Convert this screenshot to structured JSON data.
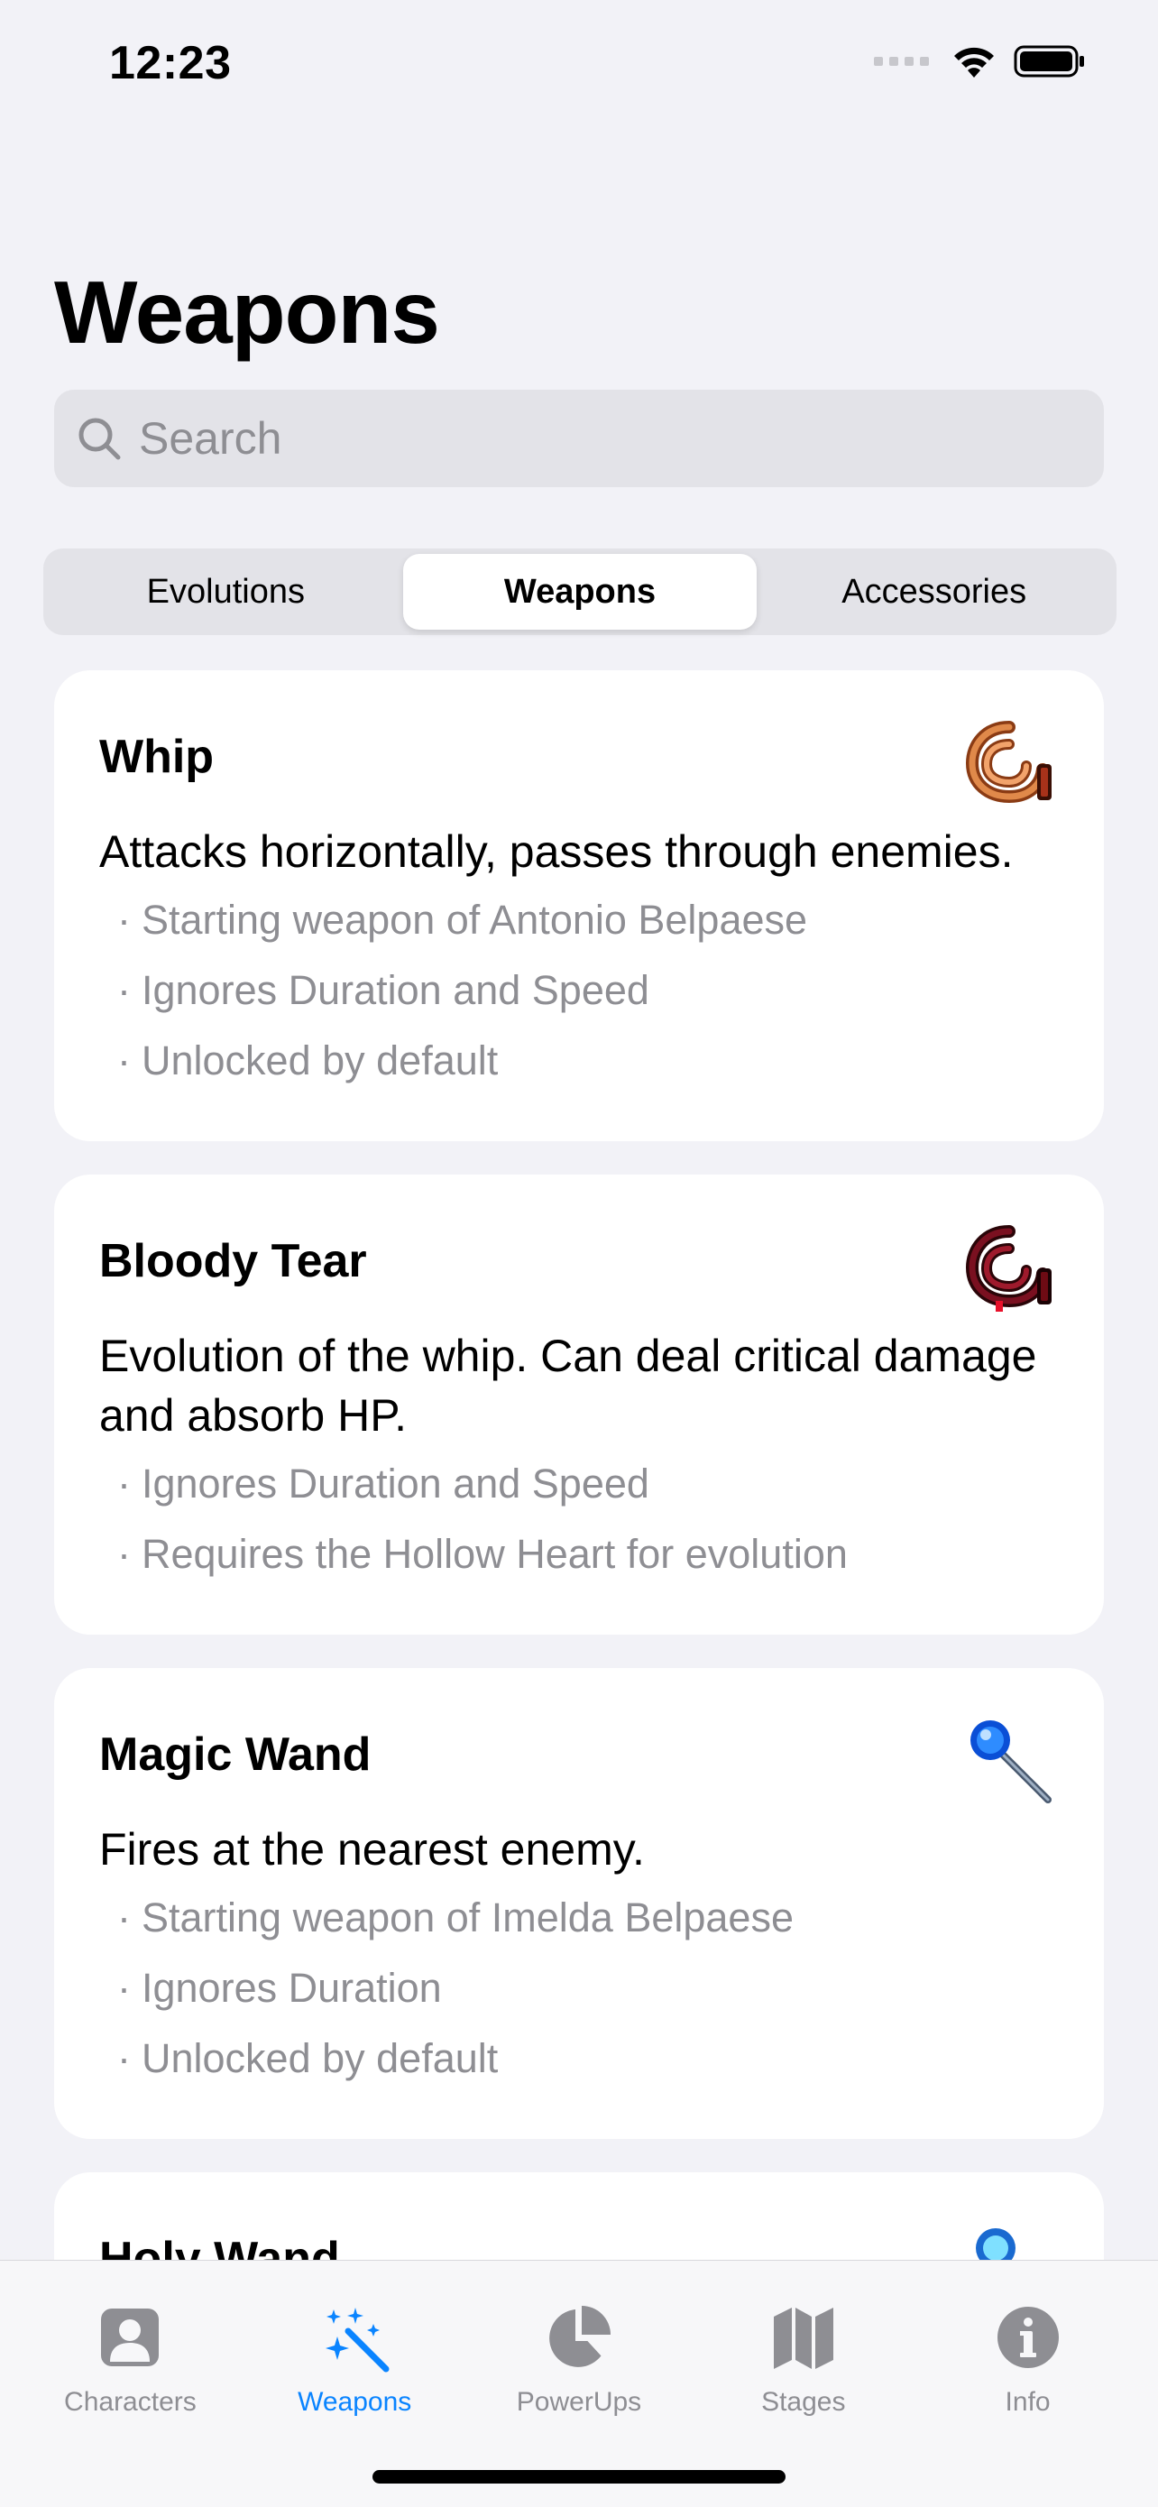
{
  "status": {
    "time": "12:23"
  },
  "nav": {
    "title": "Weapons"
  },
  "search": {
    "placeholder": "Search",
    "value": ""
  },
  "segments": [
    {
      "label": "Evolutions",
      "selected": false
    },
    {
      "label": "Weapons",
      "selected": true
    },
    {
      "label": "Accessories",
      "selected": false
    }
  ],
  "items": [
    {
      "title": "Whip",
      "icon": "whip-icon",
      "description": "Attacks horizontally, passes through enemies.",
      "notes": [
        "Starting weapon of Antonio Belpaese",
        "Ignores Duration and Speed",
        "Unlocked by default"
      ]
    },
    {
      "title": "Bloody Tear",
      "icon": "bloody-tear-icon",
      "description": "Evolution of the whip. Can deal critical damage and absorb HP.",
      "notes": [
        "Ignores Duration and Speed",
        "Requires the Hollow Heart for evolution"
      ]
    },
    {
      "title": "Magic Wand",
      "icon": "magic-wand-icon",
      "description": "Fires at the nearest enemy.",
      "notes": [
        "Starting weapon of Imelda Belpaese",
        "Ignores Duration",
        "Unlocked by default"
      ]
    },
    {
      "title": "Holy Wand",
      "icon": "holy-wand-icon",
      "description": "",
      "notes": []
    }
  ],
  "tabbar": {
    "tabs": [
      {
        "label": "Characters",
        "icon": "person-icon",
        "active": false
      },
      {
        "label": "Weapons",
        "icon": "sparkles-wand-icon",
        "active": true
      },
      {
        "label": "PowerUps",
        "icon": "pie-chart-icon",
        "active": false
      },
      {
        "label": "Stages",
        "icon": "map-icon",
        "active": false
      },
      {
        "label": "Info",
        "icon": "info-icon",
        "active": false
      }
    ]
  },
  "colors": {
    "accent": "#0a84ff",
    "background": "#f2f2f7",
    "secondary_text": "#8e8e93"
  }
}
